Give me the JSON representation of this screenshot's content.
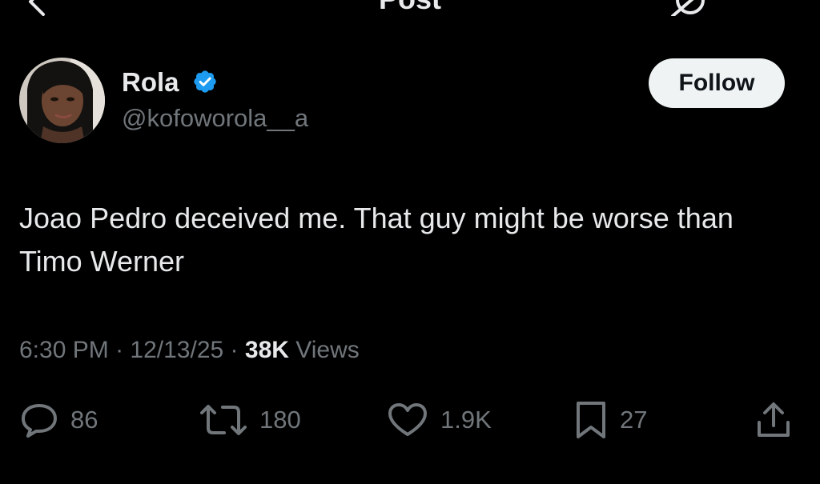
{
  "header": {
    "title": "Post"
  },
  "author": {
    "display_name": "Rola",
    "handle": "@kofoworola__a",
    "verified": true,
    "badge_color": "#1d9bf0"
  },
  "follow_button": {
    "label": "Follow"
  },
  "post": {
    "text": "Joao Pedro deceived me. That guy might be worse than Timo Werner",
    "time": "6:30 PM",
    "date": "12/13/25",
    "separator": "·",
    "views_count": "38K",
    "views_label": "Views"
  },
  "actions": {
    "replies": "86",
    "reposts": "180",
    "likes": "1.9K",
    "bookmarks": "27"
  },
  "icons": [
    "back-arrow-icon",
    "grok-icon",
    "more-icon",
    "verified-badge-icon",
    "reply-icon",
    "repost-icon",
    "like-icon",
    "bookmark-icon",
    "share-icon"
  ],
  "colors": {
    "background": "#000000",
    "text_primary": "#e7e9ea",
    "text_secondary": "#71767b",
    "follow_bg": "#eff3f4"
  }
}
